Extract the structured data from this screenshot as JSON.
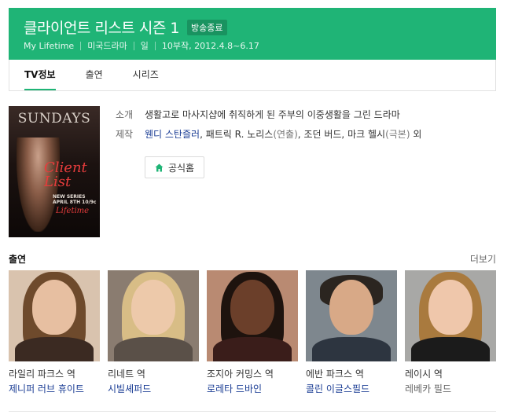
{
  "header": {
    "title": "클라이언트 리스트 시즌 1",
    "badge": "방송종료",
    "meta": [
      "My Lifetime",
      "미국드라마",
      "일",
      "10부작, 2012.4.8~6.17"
    ],
    "bg_color": "#1fb476"
  },
  "tabs": [
    {
      "label": "TV정보",
      "active": true
    },
    {
      "label": "출연",
      "active": false
    },
    {
      "label": "시리즈",
      "active": false
    }
  ],
  "poster": {
    "top_text": "SUNDAYS",
    "name_text": "Client List",
    "date_text": "NEW SERIES APRIL 8TH 10/9c",
    "logo_text": "Lifetime"
  },
  "info": {
    "intro_label": "소개",
    "intro_value": "생활고로 마사지샵에 취직하게 된 주부의 이중생활을 그린 드라마",
    "credit_label": "제작",
    "credits": {
      "p1_name": "웬디 스탄즐러",
      "p1_sep": ",",
      "p2_name": "패트릭 R. 노리스",
      "p2_role": "(연출)",
      "p2_sep": ",",
      "p3_name": "조던 버드",
      "p3_sep": ",",
      "p4_name": "마크 헬시",
      "p4_role": "(극본)",
      "suffix": "외"
    },
    "home_button": "공식홈"
  },
  "cast": {
    "title": "출연",
    "more": "더보기",
    "items": [
      {
        "role": "라일리 파크스 역",
        "actor": "제니퍼 러브 휴이트",
        "linked": true
      },
      {
        "role": "리네트 역",
        "actor": "시빌셰퍼드",
        "linked": true
      },
      {
        "role": "조지아 커밍스 역",
        "actor": "로레타 드바인",
        "linked": true
      },
      {
        "role": "에반 파크스 역",
        "actor": "콜린 이글스필드",
        "linked": true
      },
      {
        "role": "레이시 역",
        "actor": "레베카 필드",
        "linked": false
      }
    ]
  }
}
